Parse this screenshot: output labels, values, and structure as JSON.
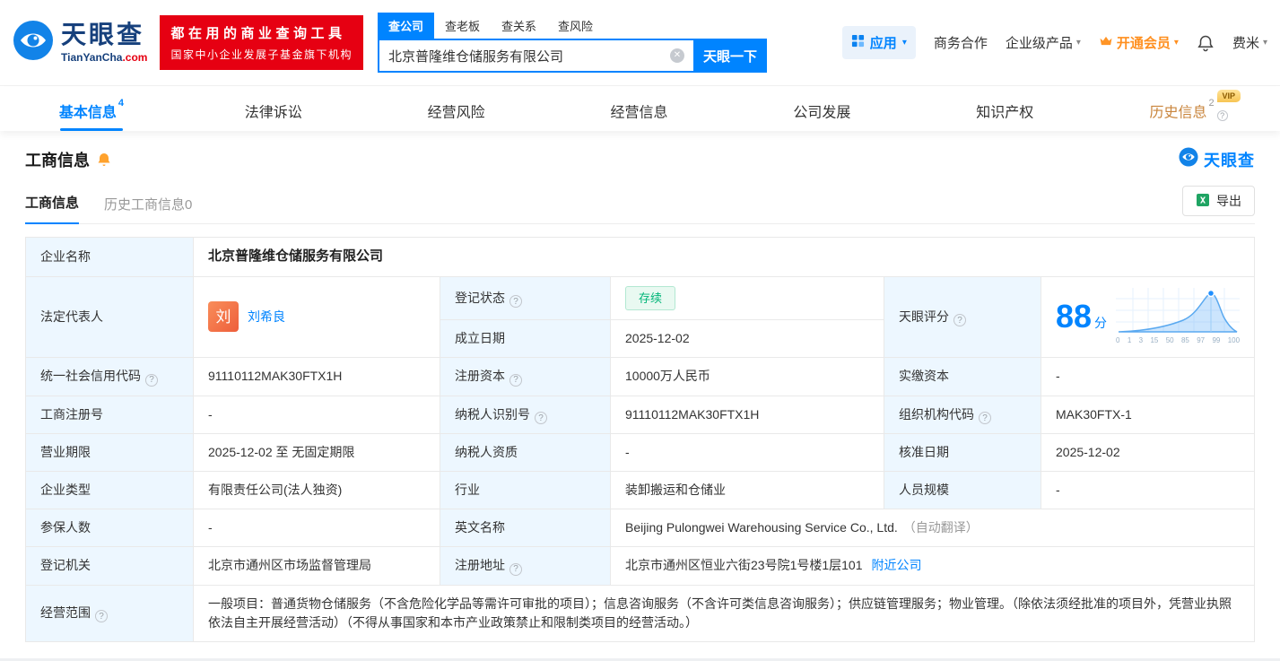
{
  "brand": {
    "cn": "天眼查",
    "en_main": "TianYanCha",
    "en_tld": ".com"
  },
  "header": {
    "banner_line1": "都在用的商业查询工具",
    "banner_line2": "国家中小企业发展子基金旗下机构",
    "search_tabs": [
      {
        "label": "查公司"
      },
      {
        "label": "查老板"
      },
      {
        "label": "查关系"
      },
      {
        "label": "查风险"
      }
    ],
    "search_value": "北京普隆维仓储服务有限公司",
    "search_button": "天眼一下",
    "apps_label": "应用",
    "cooperation_label": "商务合作",
    "enterprise_label": "企业级产品",
    "vip_label": "开通会员",
    "user_label": "费米"
  },
  "nav_tabs": [
    {
      "label": "基本信息",
      "badge": "4"
    },
    {
      "label": "法律诉讼",
      "badge": ""
    },
    {
      "label": "经营风险",
      "badge": ""
    },
    {
      "label": "经营信息",
      "badge": ""
    },
    {
      "label": "公司发展",
      "badge": ""
    },
    {
      "label": "知识产权",
      "badge": ""
    },
    {
      "label": "历史信息",
      "badge": "2",
      "tag": "VIP"
    }
  ],
  "section": {
    "title": "工商信息",
    "brand": "天眼查",
    "subtab_active": "工商信息",
    "subtab_history": "历史工商信息0",
    "export_label": "导出"
  },
  "info": {
    "name": {
      "label": "企业名称",
      "value": "北京普隆维仓储服务有限公司"
    },
    "legal": {
      "label": "法定代表人",
      "avatar": "刘",
      "link": "刘希良"
    },
    "status": {
      "label": "登记状态",
      "value": "存续"
    },
    "score": {
      "label": "天眼评分",
      "value": "88",
      "unit": "分"
    },
    "established": {
      "label": "成立日期",
      "value": "2025-12-02"
    },
    "credit_code": {
      "label": "统一社会信用代码",
      "value": "91110112MAK30FTX1H"
    },
    "reg_capital": {
      "label": "注册资本",
      "value": "10000万人民币"
    },
    "paid_capital": {
      "label": "实缴资本",
      "value": "-"
    },
    "reg_no": {
      "label": "工商注册号",
      "value": "-"
    },
    "tax_id": {
      "label": "纳税人识别号",
      "value": "91110112MAK30FTX1H"
    },
    "org_code": {
      "label": "组织机构代码",
      "value": "MAK30FTX-1"
    },
    "term": {
      "label": "营业期限",
      "value": "2025-12-02 至 无固定期限"
    },
    "tax_quality": {
      "label": "纳税人资质",
      "value": "-"
    },
    "approved": {
      "label": "核准日期",
      "value": "2025-12-02"
    },
    "type": {
      "label": "企业类型",
      "value": "有限责任公司(法人独资)"
    },
    "industry": {
      "label": "行业",
      "value": "装卸搬运和仓储业"
    },
    "staff": {
      "label": "人员规模",
      "value": "-"
    },
    "insured": {
      "label": "参保人数",
      "value": "-"
    },
    "en_name": {
      "label": "英文名称",
      "value": "Beijing Pulongwei Warehousing Service Co., Ltd.",
      "note": "（自动翻译）"
    },
    "authority": {
      "label": "登记机关",
      "value": "北京市通州区市场监督管理局"
    },
    "address": {
      "label": "注册地址",
      "value": "北京市通州区恒业六街23号院1号楼1层101",
      "link": "附近公司"
    },
    "scope": {
      "label": "经营范围",
      "value": "一般项目：普通货物仓储服务（不含危险化学品等需许可审批的项目）；信息咨询服务（不含许可类信息咨询服务）；供应链管理服务；物业管理。（除依法须经批准的项目外，凭营业执照依法自主开展经营活动）（不得从事国家和本市产业政策禁止和限制类项目的经营活动。）"
    }
  },
  "score_chart": {
    "type": "area",
    "score": 88,
    "x_ticks": [
      "0",
      "1",
      "3",
      "15",
      "50",
      "85",
      "97",
      "99",
      "100"
    ]
  }
}
